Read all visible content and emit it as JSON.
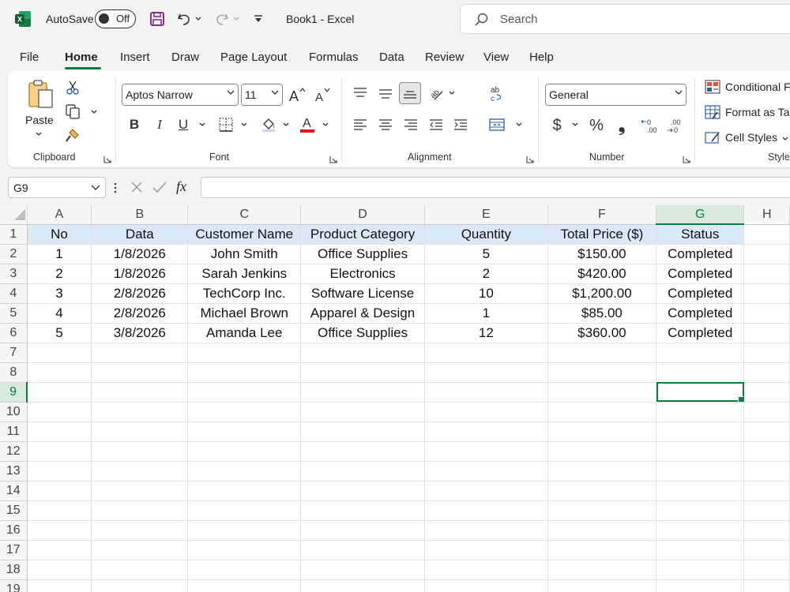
{
  "titlebar": {
    "autosave_label": "AutoSave",
    "autosave_state": "Off",
    "doc_title": "Book1  -  Excel",
    "search_placeholder": "Search"
  },
  "menu": {
    "tabs": [
      {
        "label": "File"
      },
      {
        "label": "Home",
        "active": true
      },
      {
        "label": "Insert"
      },
      {
        "label": "Draw"
      },
      {
        "label": "Page Layout"
      },
      {
        "label": "Formulas"
      },
      {
        "label": "Data"
      },
      {
        "label": "Review"
      },
      {
        "label": "View"
      },
      {
        "label": "Help"
      }
    ]
  },
  "ribbon": {
    "clipboard": {
      "paste_label": "Paste",
      "group_label": "Clipboard"
    },
    "font": {
      "font_name": "Aptos Narrow",
      "font_size": "11",
      "bold": "B",
      "italic": "I",
      "underline": "U",
      "group_label": "Font",
      "font_color": "#e81123"
    },
    "alignment": {
      "group_label": "Alignment"
    },
    "number": {
      "format": "General",
      "currency": "$",
      "percent": "%",
      "comma": "❟",
      "group_label": "Number"
    },
    "styles": {
      "conditional": "Conditional F",
      "format_table": "Format as Ta",
      "cell_styles": "Cell Styles",
      "group_label": "Style"
    }
  },
  "formula_bar": {
    "name_box": "G9",
    "fx": "fx",
    "formula": ""
  },
  "sheet": {
    "columns": [
      "A",
      "B",
      "C",
      "D",
      "E",
      "F",
      "G",
      "H"
    ],
    "selected_column": "G",
    "selected_row": 9,
    "header_row": [
      "No",
      "Data",
      "Customer Name",
      "Product Category",
      "Quantity",
      "Total Price ($)",
      "Status"
    ],
    "rows": [
      [
        "1",
        "1/8/2026",
        "John Smith",
        "Office Supplies",
        "5",
        "$150.00",
        "Completed"
      ],
      [
        "2",
        "1/8/2026",
        "Sarah Jenkins",
        "Electronics",
        "2",
        "$420.00",
        "Completed"
      ],
      [
        "3",
        "2/8/2026",
        "TechCorp Inc.",
        "Software License",
        "10",
        "$1,200.00",
        "Completed"
      ],
      [
        "4",
        "2/8/2026",
        "Michael Brown",
        "Apparel & Design",
        "1",
        "$85.00",
        "Completed"
      ],
      [
        "5",
        "3/8/2026",
        "Amanda Lee",
        "Office Supplies",
        "12",
        "$360.00",
        "Completed"
      ]
    ],
    "row_numbers": [
      "1",
      "2",
      "3",
      "4",
      "5",
      "6",
      "7",
      "8",
      "9",
      "10",
      "11",
      "12",
      "13",
      "14",
      "15",
      "16",
      "17",
      "18",
      "19"
    ],
    "accent_color": "#107c41",
    "header_fill": "#dae9f8"
  }
}
